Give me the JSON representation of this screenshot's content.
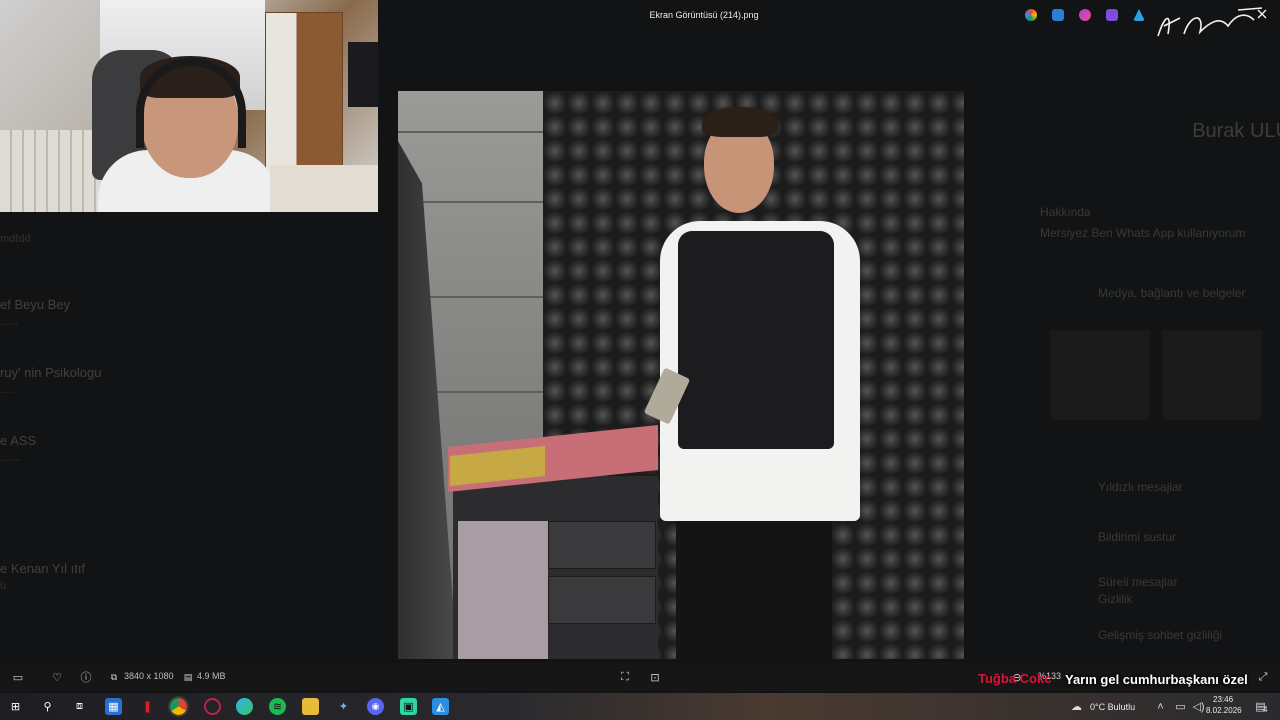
{
  "viewer": {
    "title": "Ekran Görüntüsü (214).png",
    "dimensions": "3840 x 1080",
    "filesize": "4.9 MB",
    "zoom": "%133"
  },
  "background_app": {
    "chats": [
      {
        "name": "",
        "sub": "mdfdd"
      },
      {
        "name": "ef Beyu Bey",
        "sub": "......"
      },
      {
        "name": "ruy' nin Psikologu",
        "sub": "....."
      },
      {
        "name": "e ASS",
        "sub": "......."
      },
      {
        "name": "e Kenan Yıl ıtıf",
        "sub": "ü"
      }
    ],
    "contact_name": "Burak ULU",
    "labels": {
      "about": "Hakkında",
      "about_text": "Mersiyez Ben Whats App kullanıyorum",
      "media": "Medya, bağlantı ve belgeler",
      "starred": "Yıldızlı mesajlar",
      "notifications": "Bildirimi sustur",
      "disappearing": "Süreli mesajlar",
      "encryption": "Gizlilik",
      "advanced": "Gelişmiş sohbet gizliliği"
    }
  },
  "alert": {
    "name": "Tuğba Cokc",
    "message": "Yarın gel cumhurbaşkanı özel koruması olarak başla.."
  },
  "taskbar": {
    "weather": "0°C Bulutlu",
    "time": "23:46",
    "date": "8.02.2026",
    "notification_count": "4"
  },
  "colors": {
    "alert_name": "#d5153a",
    "background": "#0f0f10"
  }
}
